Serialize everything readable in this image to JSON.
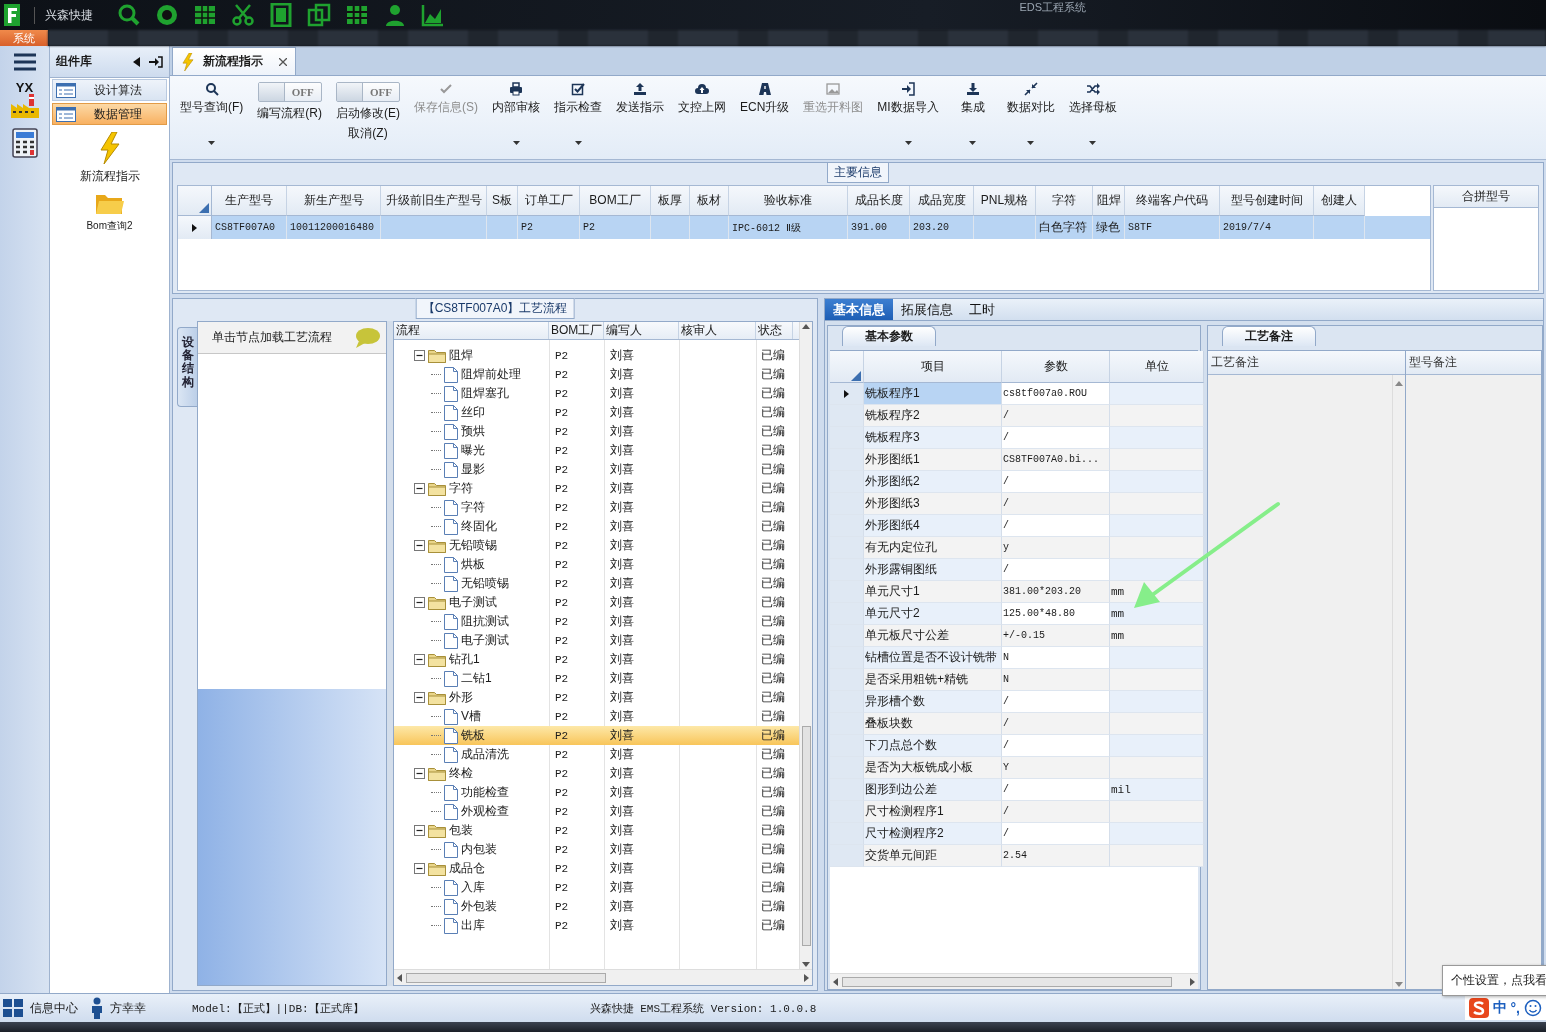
{
  "top_bar": {
    "app_name": "兴森快捷",
    "title": "EDS工程系统",
    "menu_tab": "系统"
  },
  "left_rail": {
    "logo_text": "YX"
  },
  "library": {
    "title": "组件库",
    "items": [
      {
        "label": "设计算法",
        "selected": false
      },
      {
        "label": "数据管理",
        "selected": true
      }
    ],
    "tools": [
      {
        "label": "新流程指示"
      },
      {
        "label": "Bom查询2"
      }
    ]
  },
  "tabs": [
    {
      "label": "新流程指示",
      "selected": true
    }
  ],
  "toolbar": [
    {
      "kind": "button",
      "label": "型号查询(F)",
      "disabled": false,
      "dropdown": true
    },
    {
      "kind": "toggle",
      "label": "编写流程(R)",
      "state_text": "OFF",
      "on": false
    },
    {
      "kind": "toggle",
      "label": "启动修改(E)",
      "sublabel": "取消(Z)",
      "state_text": "OFF",
      "on": false
    },
    {
      "kind": "button",
      "label": "保存信息(S)",
      "disabled": true,
      "dropdown": false
    },
    {
      "kind": "button",
      "label": "内部审核",
      "disabled": false,
      "dropdown": true
    },
    {
      "kind": "button",
      "label": "指示检查",
      "disabled": false,
      "dropdown": true
    },
    {
      "kind": "button",
      "label": "发送指示",
      "disabled": false,
      "dropdown": false
    },
    {
      "kind": "button",
      "label": "文控上网",
      "disabled": false,
      "dropdown": false
    },
    {
      "kind": "button",
      "label": "ECN升级",
      "disabled": false,
      "dropdown": false
    },
    {
      "kind": "button",
      "label": "重选开料图",
      "disabled": true,
      "dropdown": false
    },
    {
      "kind": "button",
      "label": "MI数据导入",
      "disabled": false,
      "dropdown": true
    },
    {
      "kind": "button",
      "label": "集成",
      "disabled": false,
      "dropdown": true
    },
    {
      "kind": "button",
      "label": "数据对比",
      "disabled": false,
      "dropdown": true
    },
    {
      "kind": "button",
      "label": "选择母板",
      "disabled": false,
      "dropdown": true
    }
  ],
  "main_info": {
    "title": "主要信息",
    "columns": [
      "生产型号",
      "新生产型号",
      "升级前旧生产型号",
      "S板",
      "订单工厂",
      "BOM工厂",
      "板厚",
      "板材",
      "验收标准",
      "成品长度",
      "成品宽度",
      "PNL规格",
      "字符",
      "阻焊",
      "终端客户代码",
      "型号创建时间",
      "创建人"
    ],
    "rows": [
      {
        "selected": true,
        "cells": [
          "CS8TF007A0",
          "10011200016480",
          null,
          null,
          "P2",
          "P2",
          null,
          null,
          "IPC-6012 Ⅱ级",
          "391.00",
          "203.20",
          null,
          "白色字符",
          "绿色",
          "S8TF",
          "2019/7/4",
          null
        ]
      }
    ],
    "side_column": "合拼型号"
  },
  "process": {
    "title": "【CS8TF007A0】工艺流程",
    "side_tab": "设备结构",
    "hint": "单击节点加载工艺流程",
    "columns": [
      "流程",
      "BOM工厂",
      "编写人",
      "核审人",
      "状态"
    ],
    "rows": [
      {
        "label": "阻焊",
        "kind": "folder",
        "expanded": true,
        "selected": false,
        "bom": "P2",
        "author": "刘喜",
        "status": "已编",
        "children": [
          {
            "label": "阻焊前处理",
            "kind": "file",
            "selected": false,
            "bom": "P2",
            "author": "刘喜",
            "status": "已编"
          },
          {
            "label": "阻焊塞孔",
            "kind": "file",
            "selected": false,
            "bom": "P2",
            "author": "刘喜",
            "status": "已编"
          },
          {
            "label": "丝印",
            "kind": "file",
            "selected": false,
            "bom": "P2",
            "author": "刘喜",
            "status": "已编"
          },
          {
            "label": "预烘",
            "kind": "file",
            "selected": false,
            "bom": "P2",
            "author": "刘喜",
            "status": "已编"
          },
          {
            "label": "曝光",
            "kind": "file",
            "selected": false,
            "bom": "P2",
            "author": "刘喜",
            "status": "已编"
          },
          {
            "label": "显影",
            "kind": "file",
            "selected": false,
            "bom": "P2",
            "author": "刘喜",
            "status": "已编"
          }
        ]
      },
      {
        "label": "字符",
        "kind": "folder",
        "expanded": true,
        "selected": false,
        "bom": "P2",
        "author": "刘喜",
        "status": "已编",
        "children": [
          {
            "label": "字符",
            "kind": "file",
            "selected": false,
            "bom": "P2",
            "author": "刘喜",
            "status": "已编"
          },
          {
            "label": "终固化",
            "kind": "file",
            "selected": false,
            "bom": "P2",
            "author": "刘喜",
            "status": "已编"
          }
        ]
      },
      {
        "label": "无铅喷锡",
        "kind": "folder",
        "expanded": true,
        "selected": false,
        "bom": "P2",
        "author": "刘喜",
        "status": "已编",
        "children": [
          {
            "label": "烘板",
            "kind": "file",
            "selected": false,
            "bom": "P2",
            "author": "刘喜",
            "status": "已编"
          },
          {
            "label": "无铅喷锡",
            "kind": "file",
            "selected": false,
            "bom": "P2",
            "author": "刘喜",
            "status": "已编"
          }
        ]
      },
      {
        "label": "电子测试",
        "kind": "folder",
        "expanded": true,
        "selected": false,
        "bom": "P2",
        "author": "刘喜",
        "status": "已编",
        "children": [
          {
            "label": "阻抗测试",
            "kind": "file",
            "selected": false,
            "bom": "P2",
            "author": "刘喜",
            "status": "已编"
          },
          {
            "label": "电子测试",
            "kind": "file",
            "selected": false,
            "bom": "P2",
            "author": "刘喜",
            "status": "已编"
          }
        ]
      },
      {
        "label": "钻孔1",
        "kind": "folder",
        "expanded": true,
        "selected": false,
        "bom": "P2",
        "author": "刘喜",
        "status": "已编",
        "children": [
          {
            "label": "二钻1",
            "kind": "file",
            "selected": false,
            "bom": "P2",
            "author": "刘喜",
            "status": "已编"
          }
        ]
      },
      {
        "label": "外形",
        "kind": "folder",
        "expanded": true,
        "selected": false,
        "bom": "P2",
        "author": "刘喜",
        "status": "已编",
        "children": [
          {
            "label": "V槽",
            "kind": "file",
            "selected": false,
            "bom": "P2",
            "author": "刘喜",
            "status": "已编"
          },
          {
            "label": "铣板",
            "kind": "file",
            "selected": true,
            "bom": "P2",
            "author": "刘喜",
            "status": "已编"
          },
          {
            "label": "成品清洗",
            "kind": "file",
            "selected": false,
            "bom": "P2",
            "author": "刘喜",
            "status": "已编"
          }
        ]
      },
      {
        "label": "终检",
        "kind": "folder",
        "expanded": true,
        "selected": false,
        "bom": "P2",
        "author": "刘喜",
        "status": "已编",
        "children": [
          {
            "label": "功能检查",
            "kind": "file",
            "selected": false,
            "bom": "P2",
            "author": "刘喜",
            "status": "已编"
          },
          {
            "label": "外观检查",
            "kind": "file",
            "selected": false,
            "bom": "P2",
            "author": "刘喜",
            "status": "已编"
          }
        ]
      },
      {
        "label": "包装",
        "kind": "folder",
        "expanded": true,
        "selected": false,
        "bom": "P2",
        "author": "刘喜",
        "status": "已编",
        "children": [
          {
            "label": "内包装",
            "kind": "file",
            "selected": false,
            "bom": "P2",
            "author": "刘喜",
            "status": "已编"
          }
        ]
      },
      {
        "label": "成品仓",
        "kind": "folder",
        "expanded": true,
        "selected": false,
        "bom": "P2",
        "author": "刘喜",
        "status": "已编",
        "children": [
          {
            "label": "入库",
            "kind": "file",
            "selected": false,
            "bom": "P2",
            "author": "刘喜",
            "status": "已编"
          },
          {
            "label": "外包装",
            "kind": "file",
            "selected": false,
            "bom": "P2",
            "author": "刘喜",
            "status": "已编"
          },
          {
            "label": "出库",
            "kind": "file",
            "selected": false,
            "bom": "P2",
            "author": "刘喜",
            "status": "已编"
          }
        ]
      }
    ]
  },
  "details": {
    "tabs": [
      {
        "label": "基本信息",
        "selected": true
      },
      {
        "label": "拓展信息",
        "selected": false
      },
      {
        "label": "工时",
        "selected": false
      }
    ],
    "params": {
      "tab": "基本参数",
      "columns": [
        "项目",
        "参数",
        "单位"
      ],
      "rows": [
        {
          "item": "铣板程序1",
          "value": "cs8tf007a0.ROU",
          "selected": true
        },
        {
          "item": "铣板程序2",
          "value": "/",
          "selected": false
        },
        {
          "item": "铣板程序3",
          "value": "/",
          "selected": false
        },
        {
          "item": "外形图纸1",
          "value": "CS8TF007A0.bi...",
          "selected": false
        },
        {
          "item": "外形图纸2",
          "value": "/",
          "selected": false
        },
        {
          "item": "外形图纸3",
          "value": "/",
          "selected": false
        },
        {
          "item": "外形图纸4",
          "value": "/",
          "selected": false
        },
        {
          "item": "有无内定位孔",
          "value": "y",
          "selected": false
        },
        {
          "item": "外形露铜图纸",
          "value": "/",
          "selected": false
        },
        {
          "item": "单元尺寸1",
          "value": "381.00*203.20",
          "unit": "mm",
          "selected": false
        },
        {
          "item": "单元尺寸2",
          "value": "125.00*48.80",
          "unit": "mm",
          "selected": false
        },
        {
          "item": "单元板尺寸公差",
          "value": "+/-0.15",
          "unit": "mm",
          "selected": false
        },
        {
          "item": "钻槽位置是否不设计铣带",
          "value": "N",
          "selected": false
        },
        {
          "item": "是否采用粗铣+精铣",
          "value": "N",
          "selected": false
        },
        {
          "item": "异形槽个数",
          "value": "/",
          "selected": false
        },
        {
          "item": "叠板块数",
          "value": "/",
          "selected": false
        },
        {
          "item": "下刀点总个数",
          "value": "/",
          "selected": false
        },
        {
          "item": "是否为大板铣成小板",
          "value": "Y",
          "selected": false
        },
        {
          "item": "图形到边公差",
          "value": "/",
          "unit": "mil",
          "selected": false
        },
        {
          "item": "尺寸检测程序1",
          "value": "/",
          "selected": false
        },
        {
          "item": "尺寸检测程序2",
          "value": "/",
          "selected": false
        },
        {
          "item": "交货单元间距",
          "value": "2.54",
          "selected": false
        }
      ]
    },
    "notes": {
      "tab": "工艺备注",
      "columns": [
        "工艺备注",
        "型号备注"
      ]
    }
  },
  "status_bar": {
    "info": "信息中心",
    "user": "方幸幸",
    "db": "Model:【正式】||DB:【正式库】",
    "version": "兴森快捷 EMS工程系统 Version: 1.0.0.8",
    "ime_mode": "中",
    "ime_punct": "°,"
  },
  "tooltip": "个性设置，点我看"
}
